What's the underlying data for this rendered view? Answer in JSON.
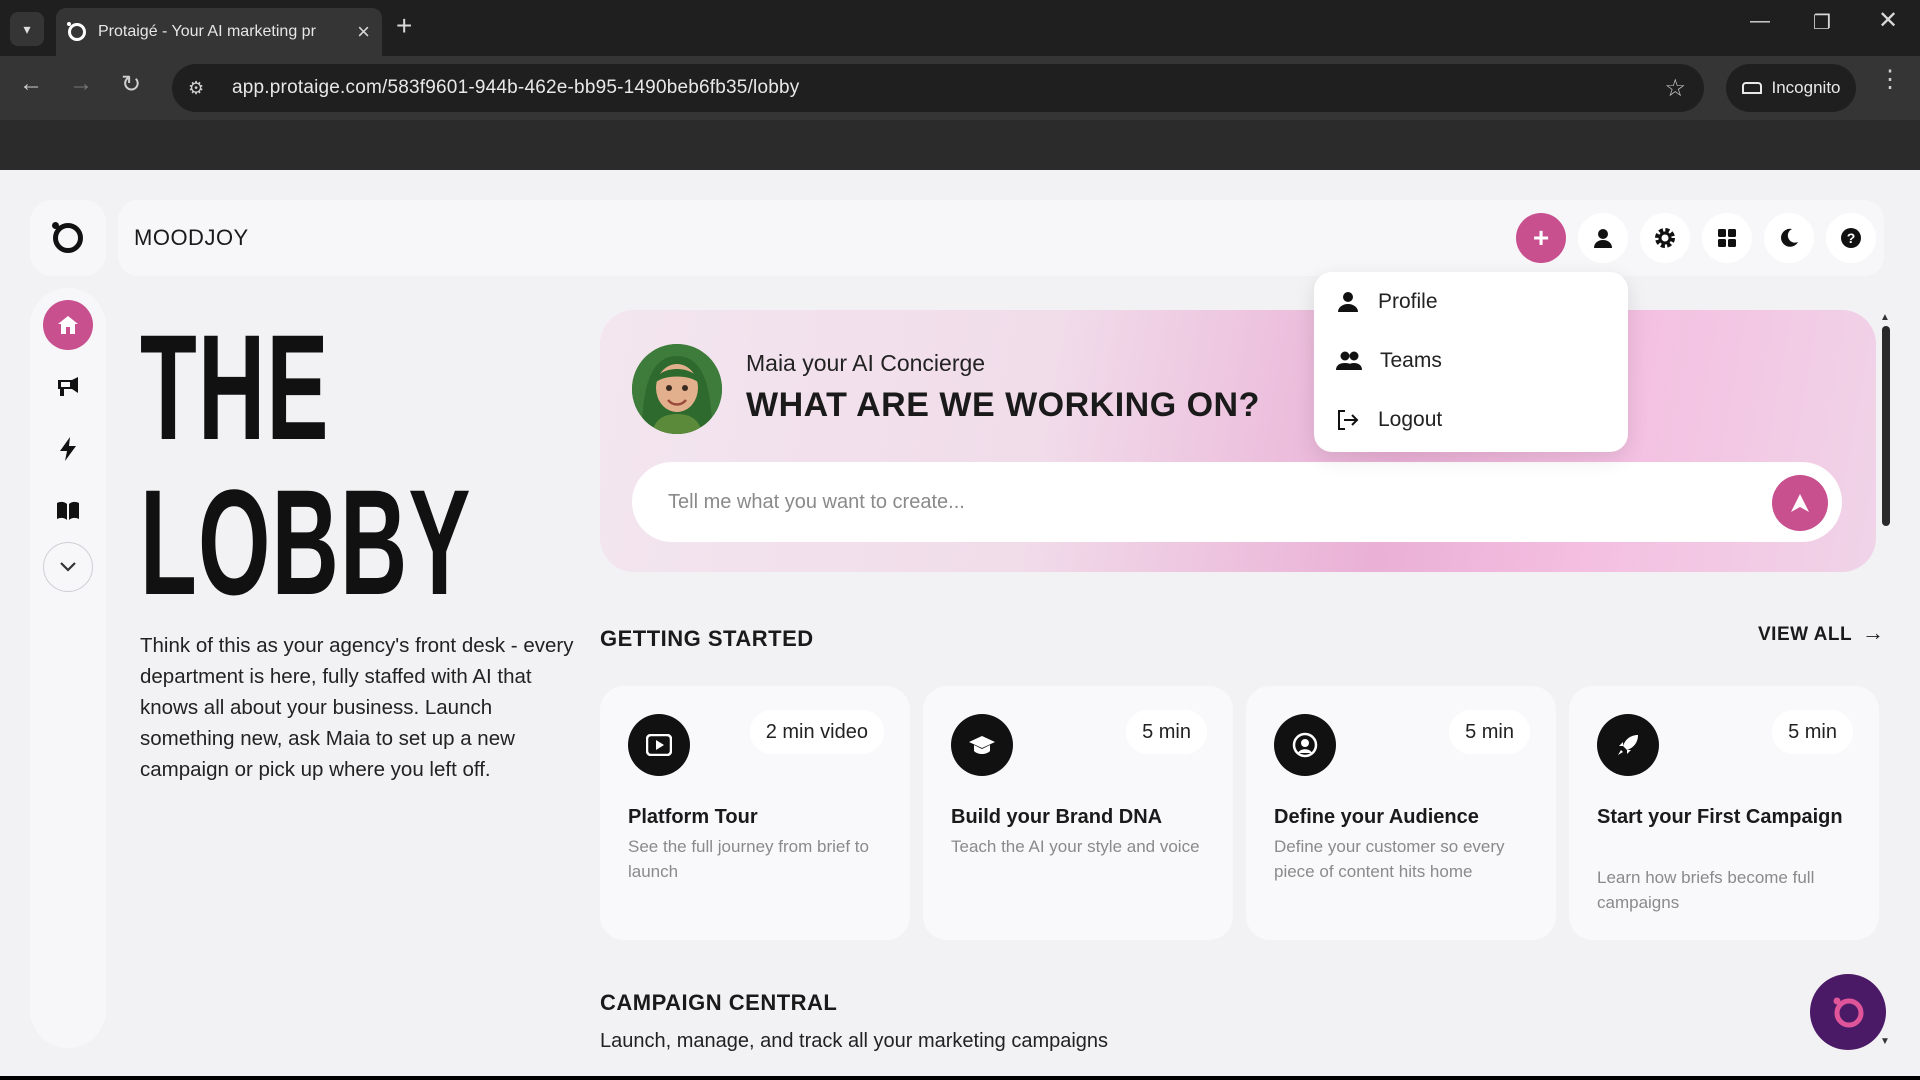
{
  "browser": {
    "tab_title": "Protaigé - Your AI marketing pr",
    "url": "app.protaige.com/583f9601-944b-462e-bb95-1490beb6fb35/lobby",
    "incognito_label": "Incognito"
  },
  "header": {
    "brand": "MOODJOY",
    "buttons": [
      "plus-icon",
      "user-icon",
      "gear-icon",
      "grid-icon",
      "moon-icon",
      "help-icon"
    ]
  },
  "sidebar": {
    "items": [
      "home-icon",
      "megaphone-icon",
      "lightning-icon",
      "book-icon",
      "chevron-down-icon"
    ]
  },
  "lobby": {
    "title_line1": "THE",
    "title_line2": "LOBBY",
    "intro": "Think of this as your agency's front desk - every department is here, fully staffed with AI that knows all about your business. Launch something new, ask Maia to set up a new campaign or pick up where you left off."
  },
  "hero": {
    "label": "Maia your AI Concierge",
    "headline": "WHAT ARE WE WORKING ON?",
    "placeholder": "Tell me what you want to create..."
  },
  "user_menu": {
    "items": [
      {
        "label": "Profile",
        "icon": "person-icon"
      },
      {
        "label": "Teams",
        "icon": "people-icon"
      },
      {
        "label": "Logout",
        "icon": "logout-icon"
      }
    ]
  },
  "getting_started": {
    "title": "GETTING STARTED",
    "view_all": "VIEW ALL",
    "cards": [
      {
        "icon": "play-icon",
        "badge": "2 min video",
        "title": "Platform Tour",
        "desc": "See the full journey from brief to launch"
      },
      {
        "icon": "graduation-cap-icon",
        "badge": "5 min",
        "title": "Build your Brand DNA",
        "desc": "Teach the AI your style and voice"
      },
      {
        "icon": "target-user-icon",
        "badge": "5 min",
        "title": "Define your Audience",
        "desc": "Define your customer so every piece of content hits home"
      },
      {
        "icon": "rocket-icon",
        "badge": "5 min",
        "title": "Start your First Campaign",
        "desc": "Learn how briefs become full campaigns"
      }
    ]
  },
  "campaign_central": {
    "title": "CAMPAIGN CENTRAL",
    "subtitle": "Launch, manage, and track all your marketing campaigns"
  },
  "colors": {
    "accent": "#c9508f",
    "fab": "#4a1a66"
  }
}
